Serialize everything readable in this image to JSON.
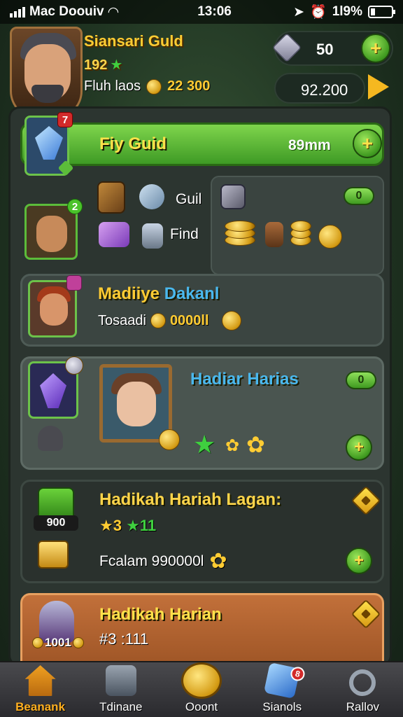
{
  "status_bar": {
    "carrier": "Mac Doouiv",
    "time": "13:06",
    "battery": "1l9%"
  },
  "player": {
    "name": "Siansari Guld",
    "level": "192",
    "club_label": "Fluh laos",
    "club_value": "22 300"
  },
  "currency": {
    "gems": "50",
    "gold": "92.200"
  },
  "cards": {
    "featured": {
      "title": "Fiy Guid",
      "timer": "89mm",
      "badge": "7"
    },
    "loot": {
      "label_guild": "Guil",
      "label_find": "Find",
      "count": "0",
      "badge": "2"
    },
    "daily1": {
      "title_gold": "Madiiye",
      "title_blue": "Dakanl",
      "sub_label": "Tosaadi",
      "sub_value": "0000ll"
    },
    "daily2": {
      "title": "Hadiar Harias",
      "count": "0"
    },
    "daily3": {
      "title": "Hadikah Hariah Lagan:",
      "stars": "3",
      "green_value": "11",
      "chest_value": "900",
      "line3": "Fcalam 990000l"
    },
    "daily4": {
      "title": "Hadikah Harian",
      "line2": "#3 :111",
      "helm_value": "1001"
    }
  },
  "nav": [
    {
      "label": "Beanank",
      "icon": "home-icon",
      "active": true
    },
    {
      "label": "Tdinane",
      "icon": "inventory-icon",
      "active": false
    },
    {
      "label": "Ooont",
      "icon": "compass-icon",
      "active": false
    },
    {
      "label": "Sianols",
      "icon": "crystal-icon",
      "active": false,
      "badge": "8"
    },
    {
      "label": "Rallov",
      "icon": "magnifier-icon",
      "active": false
    }
  ],
  "colors": {
    "accent_gold": "#ffcc33",
    "accent_green": "#5cbc3a",
    "accent_blue": "#4ab8ee",
    "active_nav": "#ffb020"
  }
}
